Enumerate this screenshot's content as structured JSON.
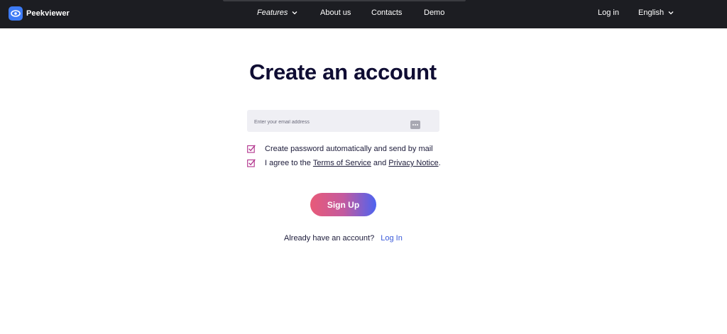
{
  "brand": {
    "name": "Peekviewer",
    "icon": "eye-icon",
    "color": "#3d7bf5"
  },
  "nav": {
    "features": "Features",
    "about": "About us",
    "contacts": "Contacts",
    "demo": "Demo",
    "login": "Log in",
    "language": "English"
  },
  "main": {
    "title": "Create an account",
    "email_placeholder": "Enter your email address",
    "email_value": "",
    "option_auto_password": "Create password automatically and send by mail",
    "agree_prefix": "I agree to the ",
    "terms_link": "Terms of Service",
    "agree_and": " and ",
    "privacy_link": "Privacy Notice",
    "agree_suffix": ".",
    "signup_label": "Sign Up",
    "already_text": "Already have an account?",
    "login_link": "Log In"
  },
  "colors": {
    "nav_bg": "#1c1d22",
    "accent_pink": "#e85a78",
    "accent_blue": "#4d63f0",
    "link_blue": "#3a5ad9",
    "check_color": "#b0308a"
  }
}
